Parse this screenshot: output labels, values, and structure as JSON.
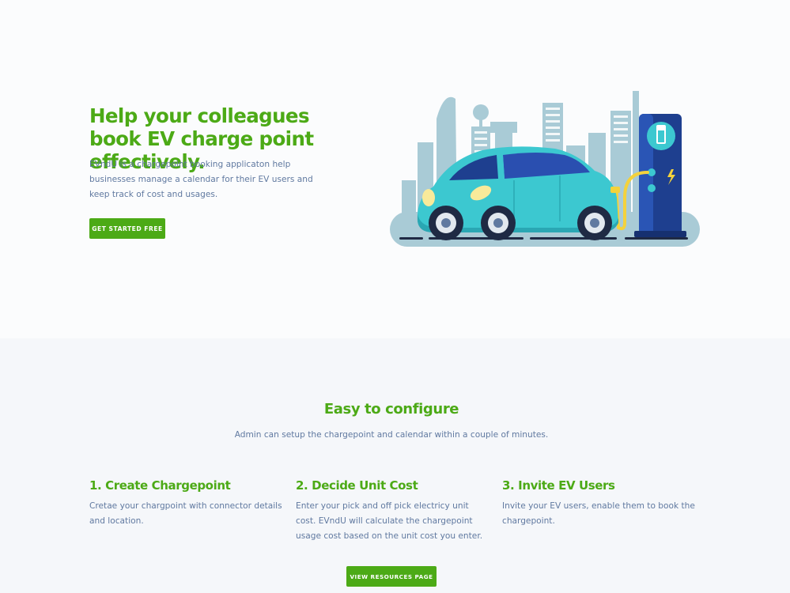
{
  "hero": {
    "title": "Help your colleagues book EV charge point effectively.",
    "description": "EVndU is a chargepoint booking applicaton help businesses manage a calendar for their EV users and keep track of cost and usages.",
    "cta_label": "GET STARTED FREE",
    "illustration": "electric-car-charging-illustration"
  },
  "features": {
    "title": "Easy to configure",
    "subtitle": "Admin can setup the chargepoint and calendar within a couple of minutes.",
    "items": [
      {
        "title": "1. Create Chargepoint",
        "text": "Cretae your chargpoint with connector details and location."
      },
      {
        "title": "2. Decide Unit Cost",
        "text": "Enter your pick and off pick electricy unit cost. EVndU will calculate the chargepoint usage cost based on the unit cost you enter."
      },
      {
        "title": "3. Invite EV Users",
        "text": "Invite your EV users, enable them to book the chargepoint."
      }
    ],
    "cta_label": "VIEW RESOURCES PAGE"
  },
  "colors": {
    "brand_green": "#4caa16",
    "body_text": "#6079a0",
    "hero_background": "#fbfcfd",
    "section_background": "#f5f7fa"
  }
}
